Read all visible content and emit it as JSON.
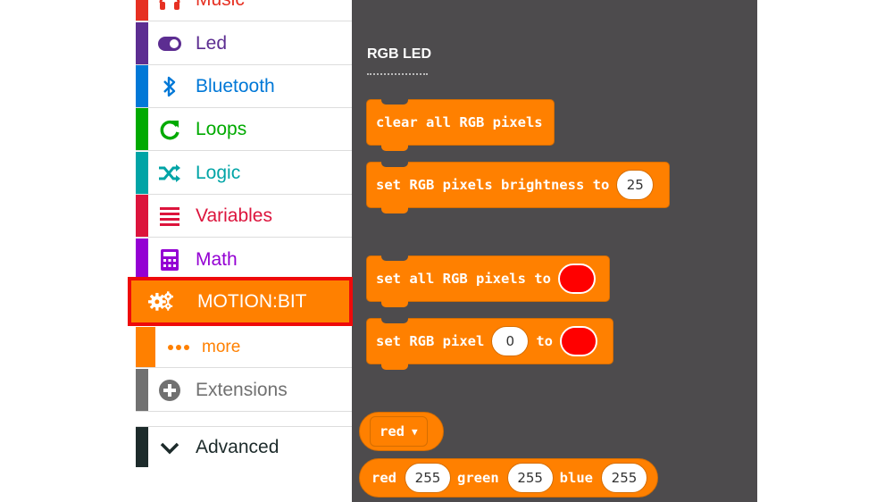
{
  "toolbox": {
    "categories": [
      {
        "label": "Music",
        "color": "#e63022",
        "icon": "headphones-icon"
      },
      {
        "label": "Led",
        "color": "#5c2d91",
        "icon": "toggle-icon"
      },
      {
        "label": "Bluetooth",
        "color": "#0078d7",
        "icon": "bluetooth-icon"
      },
      {
        "label": "Loops",
        "color": "#00aa00",
        "icon": "loop-arrow-icon"
      },
      {
        "label": "Logic",
        "color": "#00a4a6",
        "icon": "shuffle-icon"
      },
      {
        "label": "Variables",
        "color": "#dc143c",
        "icon": "list-lines-icon"
      },
      {
        "label": "Math",
        "color": "#9400d3",
        "icon": "calculator-icon"
      },
      {
        "label": "MOTION:BIT",
        "color": "#ff8000",
        "icon": "gears-icon"
      },
      {
        "label": "more",
        "color": "#ff8000",
        "icon": "dots-icon"
      },
      {
        "label": "Extensions",
        "color": "#717171",
        "icon": "plus-circle-icon"
      },
      {
        "label": "Advanced",
        "color": "#1d2b2b",
        "icon": "chevron-down-icon"
      }
    ]
  },
  "flyout": {
    "title": "RGB LED",
    "blocks": {
      "clear": "clear all RGB pixels",
      "brightness_label": "set RGB pixels brightness to",
      "brightness_value": "25",
      "set_all_label": "set all RGB pixels to",
      "set_pixel_label": "set RGB pixel",
      "set_pixel_index": "0",
      "set_pixel_to": "to",
      "color_dropdown": "red",
      "rgb_red_label": "red",
      "rgb_red_value": "255",
      "rgb_green_label": "green",
      "rgb_green_value": "255",
      "rgb_blue_label": "blue",
      "rgb_blue_value": "255"
    }
  },
  "colors": {
    "block_orange": "#ff8000",
    "flyout_bg": "#4d4b4d",
    "highlight_red": "#ee0a0a",
    "swatch_red": "#ff0000"
  }
}
